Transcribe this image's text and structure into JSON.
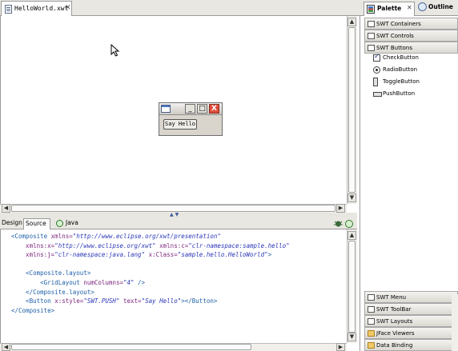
{
  "editor": {
    "tab_label": "HelloWorld.xwt",
    "tab_close": "✕"
  },
  "shell": {
    "min_label": "_",
    "max_label": "□",
    "close_label": "X",
    "button_label": "Say Hello"
  },
  "mode_tabs": {
    "design": "Design",
    "source": "Source",
    "java": "Java"
  },
  "source_lines": [
    [
      {
        "c": "tag",
        "t": "<Composite "
      },
      {
        "c": "attr",
        "t": "xmlns="
      },
      {
        "c": "val",
        "t": "\"http://www.eclipse.org/xwt/presentation\""
      }
    ],
    [
      {
        "c": "attr",
        "t": "    xmlns:x="
      },
      {
        "c": "val",
        "t": "\"http://www.eclipse.org/xwt\""
      },
      {
        "c": "attr",
        "t": " xmlns:c="
      },
      {
        "c": "val",
        "t": "\"clr-namespace:sample.hello\""
      }
    ],
    [
      {
        "c": "attr",
        "t": "    xmlns:j="
      },
      {
        "c": "val",
        "t": "\"clr-namespace:java.lang\""
      },
      {
        "c": "attr",
        "t": " x:Class="
      },
      {
        "c": "val",
        "t": "\"sample.hello.HelloWorld\""
      },
      {
        "c": "tag",
        "t": ">"
      }
    ],
    [
      {
        "c": "tag",
        "t": ""
      }
    ],
    [
      {
        "c": "tag",
        "t": "    <Composite.layout>"
      }
    ],
    [
      {
        "c": "tag",
        "t": "        <GridLayout "
      },
      {
        "c": "attr",
        "t": "numColumns="
      },
      {
        "c": "val",
        "t": "\"4\""
      },
      {
        "c": "tag",
        "t": " />"
      }
    ],
    [
      {
        "c": "tag",
        "t": "    </Composite.layout>"
      }
    ],
    [
      {
        "c": "tag",
        "t": "    <Button "
      },
      {
        "c": "attr",
        "t": "x:style="
      },
      {
        "c": "val",
        "t": "\"SWT.PUSH\""
      },
      {
        "c": "attr",
        "t": " text="
      },
      {
        "c": "val",
        "t": "\"Say Hello\""
      },
      {
        "c": "tag",
        "t": "></Button>"
      }
    ],
    [
      {
        "c": "tag",
        "t": "</Composite>"
      }
    ]
  ],
  "right_pane": {
    "palette_tab": "Palette",
    "palette_close": "✕",
    "outline_tab": "Outline",
    "drawers_top": [
      "SWT Containers",
      "SWT Controls",
      "SWT Buttons"
    ],
    "button_items": [
      "CheckButton",
      "RadioButton",
      "ToggleButton",
      "PushButton"
    ],
    "drawers_bottom": [
      "SWT Menu",
      "SWT ToolBar",
      "SWT Layouts",
      "JFace Viewers",
      "Data Binding"
    ]
  },
  "colors": {
    "tag": "#1d5fa8",
    "attribute": "#7a1f7a",
    "value": "#2a36b8",
    "chrome": "#e9e7e1",
    "close_button": "#e04d3a"
  }
}
